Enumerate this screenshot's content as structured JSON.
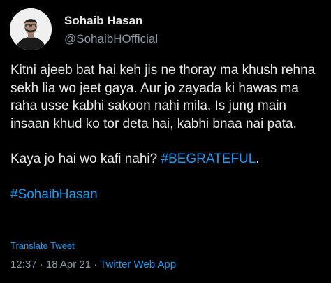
{
  "author": {
    "name": "Sohaib Hasan",
    "handle": "@SohaibHOfficial"
  },
  "tweet": {
    "paragraph1": "Kitni ajeeb bat hai keh jis ne thoray ma khush rehna sekh lia wo jeet gaya. Aur jo zayada ki hawas ma raha usse kabhi sakoon nahi mila. Is jung main insaan khud ko tor deta hai, kabhi bnaa nai pata.",
    "paragraph2_text": "Kaya jo hai wo kafi nahi? ",
    "hashtag1": "#BEGRATEFUL",
    "paragraph2_suffix": ".",
    "hashtag2": "#SohaibHasan"
  },
  "actions": {
    "translate_label": "Translate Tweet"
  },
  "meta": {
    "time": "12:37",
    "date": "18 Apr 21",
    "separator": " · ",
    "source": "Twitter Web App"
  },
  "colors": {
    "background": "#000000",
    "text": "#e7e9ea",
    "secondary": "#8b98a5",
    "link": "#1d9bf0"
  }
}
